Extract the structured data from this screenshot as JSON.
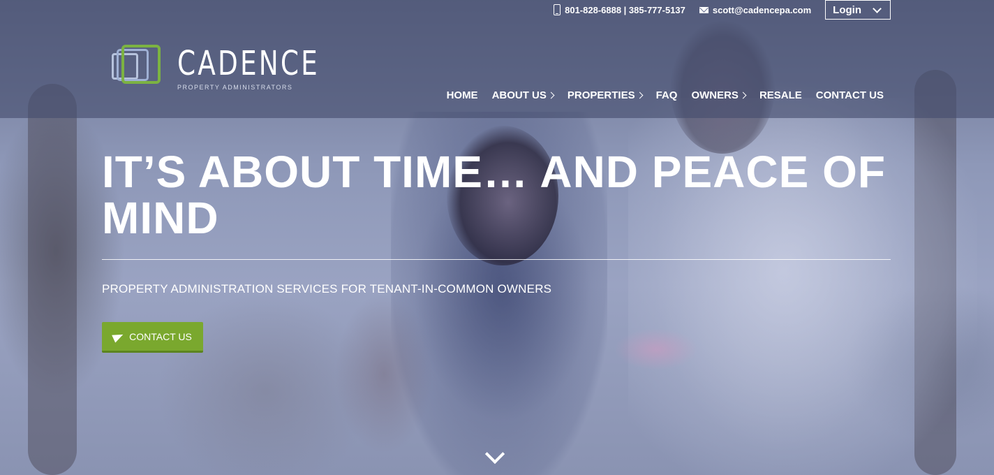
{
  "header": {
    "phone": "801-828-6888 | 385-777-5137",
    "email": "scott@cadencepa.com",
    "login_label": "Login"
  },
  "logo": {
    "name": "CADENCE",
    "tagline": "PROPERTY ADMINISTRATORS"
  },
  "nav": {
    "items": [
      {
        "label": "HOME"
      },
      {
        "label": "ABOUT US"
      },
      {
        "label": "PROPERTIES"
      },
      {
        "label": "FAQ"
      },
      {
        "label": "OWNERS"
      },
      {
        "label": "RESALE"
      },
      {
        "label": "CONTACT US"
      }
    ]
  },
  "hero": {
    "title": "IT’S ABOUT TIME… AND PEACE OF MIND",
    "subtitle": "PROPERTY ADMINISTRATION SERVICES FOR TENANT-IN-COMMON OWNERS",
    "cta_label": "CONTACT US"
  },
  "colors": {
    "accent_green": "#7aa82e",
    "header_overlay": "#464e6e"
  },
  "icons": {
    "phone": "phone-icon",
    "email": "mail-icon",
    "login_dropdown": "chevron-down-icon",
    "cta": "send-icon",
    "scroll": "chevron-down-icon"
  }
}
